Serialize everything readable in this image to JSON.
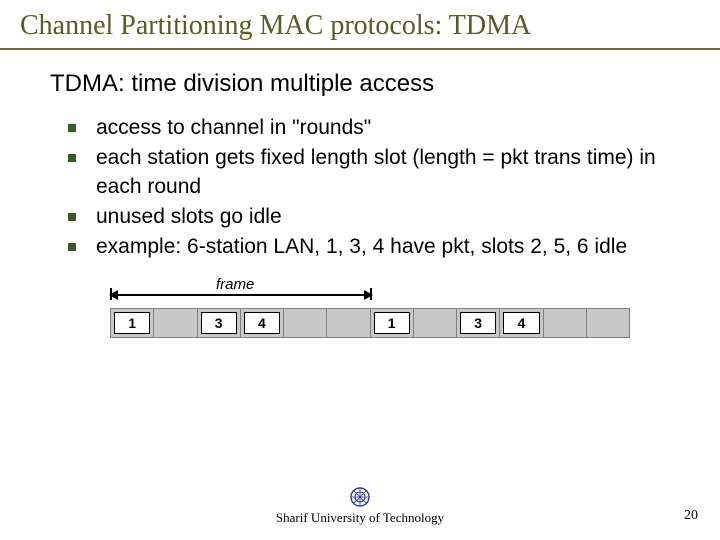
{
  "title": "Channel Partitioning MAC protocols: TDMA",
  "subtitle": "TDMA: time division multiple access",
  "bullets": [
    "access to channel in \"rounds\"",
    "each station gets fixed length slot (length = pkt trans time) in each round",
    "unused slots go idle",
    "example: 6-station LAN, 1, 3, 4 have pkt, slots 2, 5, 6 idle"
  ],
  "diagram": {
    "frame_label": "frame",
    "slots_per_frame": 6,
    "frames_shown": 2,
    "active_slots": [
      "1",
      null,
      "3",
      "4",
      null,
      null,
      "1",
      null,
      "3",
      "4",
      null,
      null
    ]
  },
  "footer": "Sharif University of Technology",
  "page_number": "20"
}
